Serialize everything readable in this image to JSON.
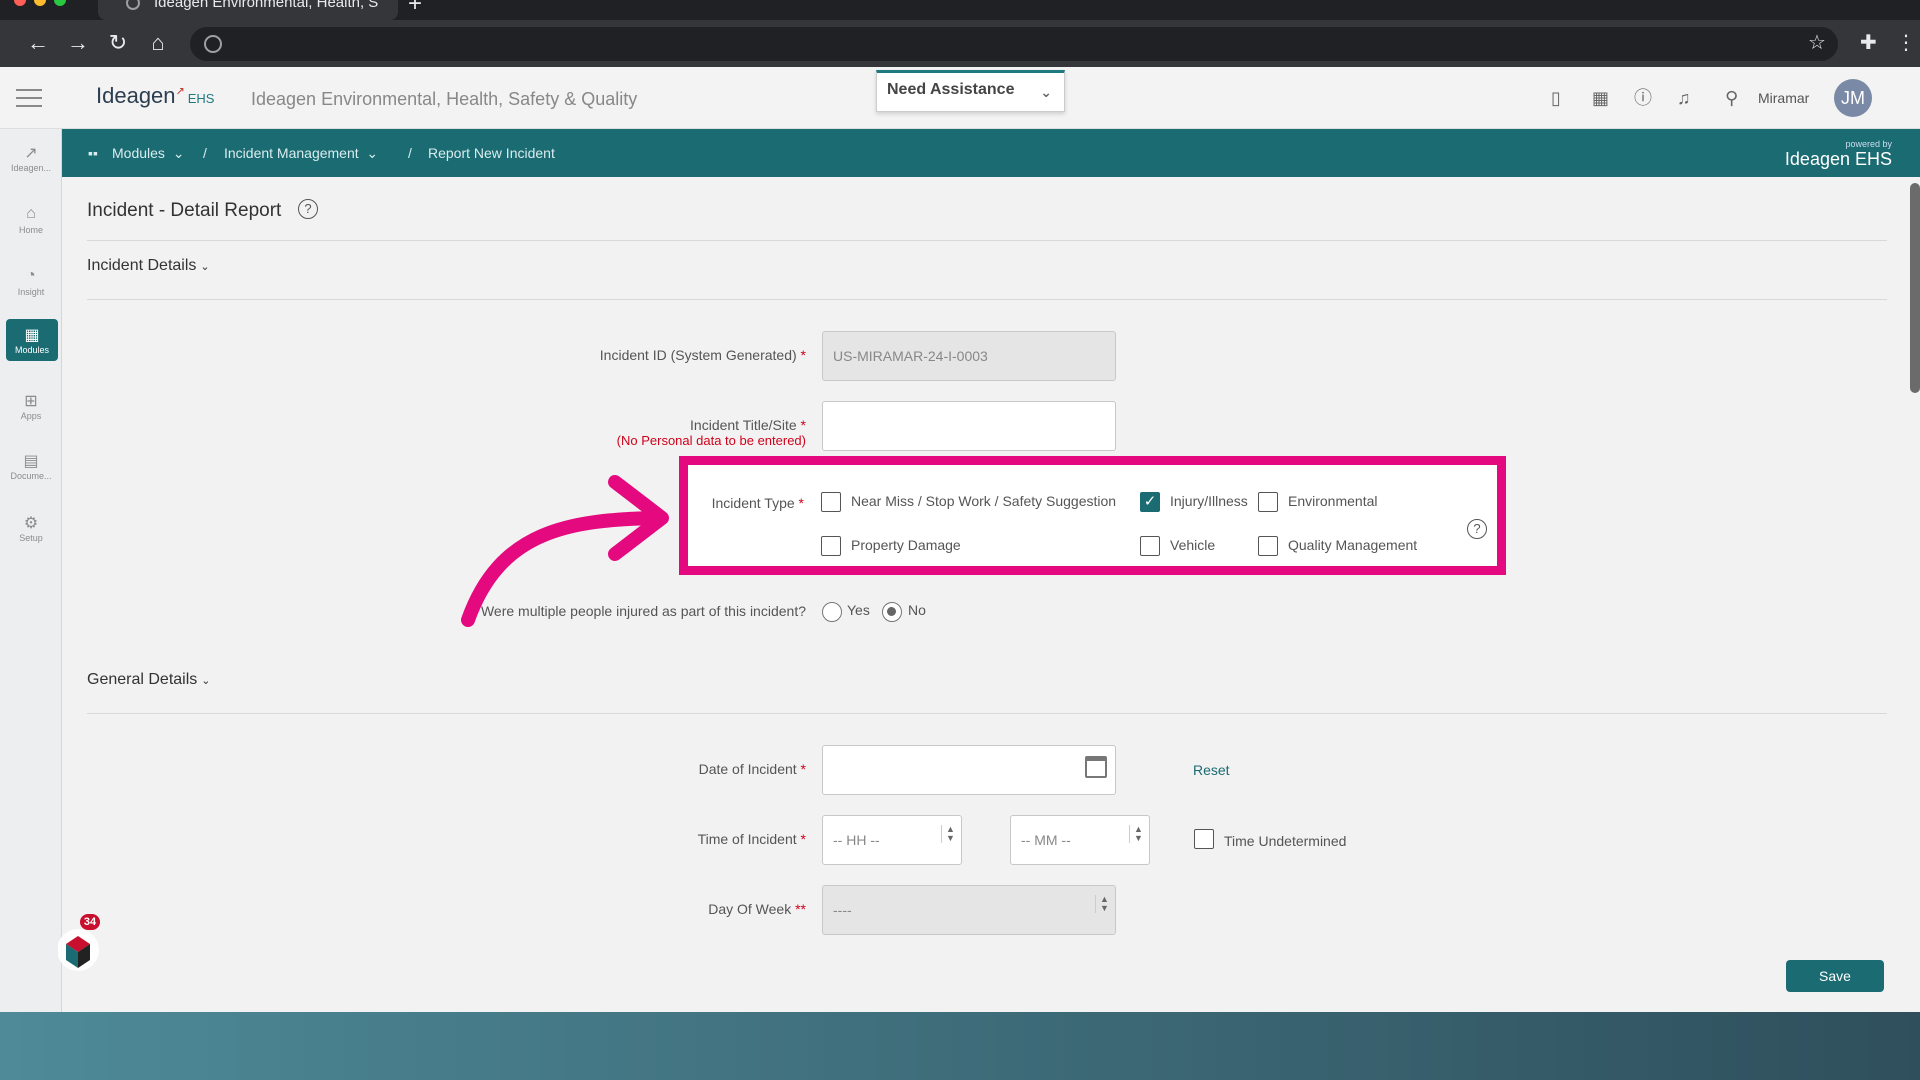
{
  "browser": {
    "tab_title": "Ideagen Environmental, Health, S"
  },
  "header": {
    "logo_text": "Ideagen",
    "logo_suffix": "EHS",
    "app_title": "Ideagen Environmental, Health, Safety & Quality",
    "need_assistance": "Need Assistance",
    "location": "Miramar",
    "avatar_initials": "JM"
  },
  "rail": {
    "items": [
      {
        "label": "Ideagen...",
        "icon": "ideagen-icon"
      },
      {
        "label": "Home",
        "icon": "home-icon"
      },
      {
        "label": "Insight",
        "icon": "insight-icon"
      },
      {
        "label": "Modules",
        "icon": "modules-icon"
      },
      {
        "label": "Apps",
        "icon": "apps-icon"
      },
      {
        "label": "Docume...",
        "icon": "document-icon"
      },
      {
        "label": "Setup",
        "icon": "gear-icon"
      }
    ]
  },
  "breadcrumb": {
    "modules": "Modules",
    "incident_management": "Incident Management",
    "current": "Report New Incident",
    "powered_by": "powered by",
    "powered_brand": "Ideagen EHS"
  },
  "page": {
    "title": "Incident - Detail Report",
    "section_incident": "Incident Details",
    "section_general": "General Details"
  },
  "form": {
    "incident_id_label": "Incident ID (System Generated)",
    "incident_id_value": "US-MIRAMAR-24-I-0003",
    "title_label": "Incident Title/Site",
    "title_note": "(No Personal data to be entered)",
    "title_value": "",
    "incident_type_label": "Incident Type",
    "incident_types": [
      {
        "label": "Near Miss / Stop Work / Safety Suggestion",
        "checked": false
      },
      {
        "label": "Injury/Illness",
        "checked": true
      },
      {
        "label": "Environmental",
        "checked": false
      },
      {
        "label": "Property Damage",
        "checked": false
      },
      {
        "label": "Vehicle",
        "checked": false
      },
      {
        "label": "Quality Management",
        "checked": false
      }
    ],
    "multiple_injured_label": "Were multiple people injured as part of this incident?",
    "yes": "Yes",
    "no": "No",
    "multiple_injured_value": "No",
    "date_label": "Date of Incident",
    "reset": "Reset",
    "time_label": "Time of Incident",
    "hh_placeholder": "-- HH --",
    "mm_placeholder": "-- MM --",
    "time_undetermined": "Time Undetermined",
    "day_label": "Day Of Week",
    "day_placeholder": "----",
    "save": "Save"
  },
  "widget": {
    "badge_count": "34"
  },
  "colors": {
    "brand_teal": "#1a6b72",
    "highlight_pink": "#e5097f",
    "required_red": "#d0021b"
  }
}
